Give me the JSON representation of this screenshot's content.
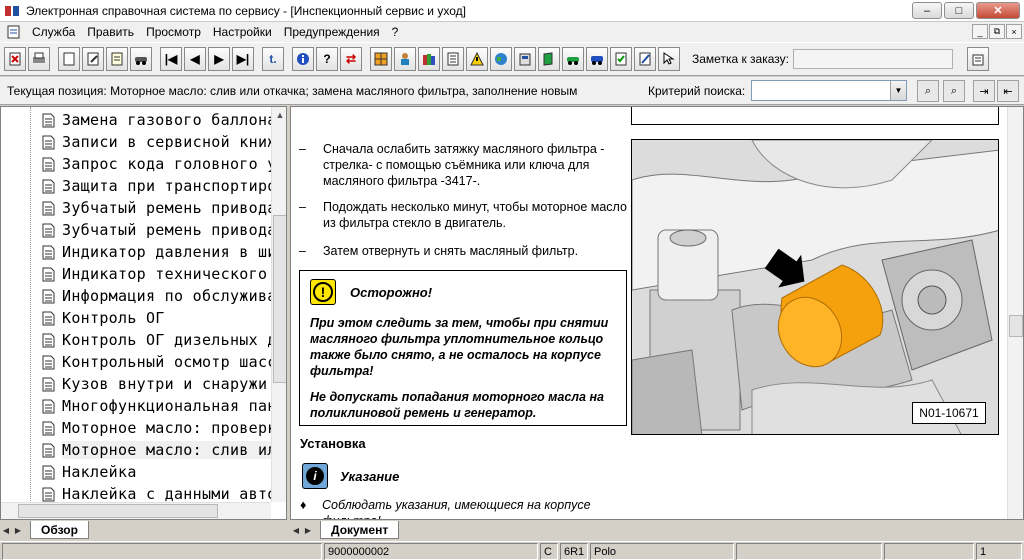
{
  "window": {
    "title": "Электронная справочная система по сервису - [Инспекционный сервис и уход]",
    "minimize": "–",
    "maximize": "□",
    "close": "✕"
  },
  "menu": {
    "items": [
      "Служба",
      "Править",
      "Просмотр",
      "Настройки",
      "Предупреждения",
      "?"
    ],
    "mdi": [
      "_",
      "⧉",
      "×"
    ]
  },
  "toolbar": {
    "order_note_label": "Заметка к заказу:",
    "order_note_value": ""
  },
  "position": {
    "label": "Текущая позиция: Моторное масло: слив или откачка; замена масляного фильтра, заполнение новым",
    "search_label": "Критерий поиска:",
    "search_value": ""
  },
  "tree": {
    "items": [
      "Замена газового баллона",
      "Записи в сервисной книжке",
      "Запрос кода головного устройства",
      "Защита при транспортировке",
      "Зубчатый ремень привода ГРМ",
      "Зубчатый ремень привода ТНВД",
      "Индикатор давления в шинах",
      "Индикатор технического обслуживания",
      "Информация по обслуживанию",
      "Контроль ОГ",
      "Контроль ОГ дизельных двигателей",
      "Контрольный осмотр шасси",
      "Кузов внутри и снаружи",
      "Многофункциональная панель",
      "Моторное масло: проверка уровня",
      "Моторное масло: слив или откачка",
      "Наклейка",
      "Наклейка с данными автомобиля"
    ],
    "selected_index": 15
  },
  "tabs": {
    "left": "Обзор",
    "right": "Документ"
  },
  "document": {
    "steps": [
      "Сначала ослабить затяжку масляного фильтра - стрелка- с помощью съёмника или ключа для масляного фильтра -3417-.",
      "Подождать несколько минут, чтобы моторное масло из фильтра стекло в двигатель.",
      "Затем отвернуть и снять масляный фильтр."
    ],
    "step_marker": "–",
    "caution_title": "Осторожно!",
    "caution_icon": "!",
    "caution_text_1": "При этом следить за тем, чтобы при снятии масляного фильтра уплотнительное кольцо также было снято, а не осталось на корпусе фильтра!",
    "caution_text_2": "Не допускать попадания моторного масла на поликлиновой ремень и генератор.",
    "section_title": "Установка",
    "note_title": "Указание",
    "note_icon": "i",
    "bullet_marker": "♦",
    "bullet_text": "Соблюдать указания, имеющиеся на корпусе фильтра!",
    "figure_label": "N01-10671"
  },
  "status": {
    "code": "9000000002",
    "c": "C",
    "model_code": "6R1",
    "model": "Polo",
    "page": "1"
  },
  "colors": {
    "filter_orange": "#f5a10e",
    "caution_yellow": "#ffe600",
    "note_blue": "#6ea7d8"
  }
}
